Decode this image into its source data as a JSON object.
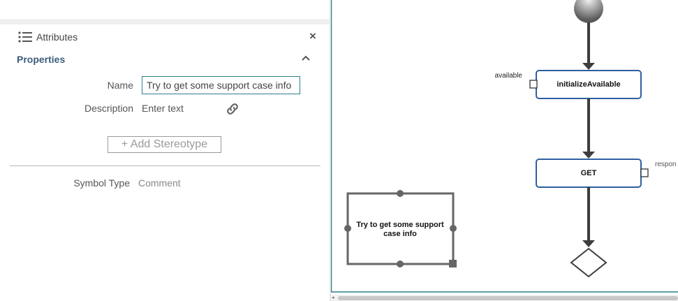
{
  "panel": {
    "title": "Attributes",
    "close_label": "×",
    "section_title": "Properties",
    "fields": {
      "name_label": "Name",
      "name_value": "Try to get some support case info",
      "description_label": "Description",
      "description_value": "Enter text",
      "stereotype_button": "+ Add Stereotype",
      "symbol_type_label": "Symbol Type",
      "symbol_type_value": "Comment"
    }
  },
  "diagram": {
    "nodes": {
      "initialize": "initializeAvailable",
      "get": "GET",
      "comment": [
        "Try to get some support",
        "case info"
      ]
    },
    "ports": {
      "available": "available",
      "response": "respon"
    }
  },
  "colors": {
    "accent": "#2e7d8c",
    "node_border": "#2f5f9e",
    "edge": "#3d3d3d",
    "section_title": "#3b5d7a"
  },
  "icons": [
    "list-icon",
    "close-icon",
    "chevron-up-icon",
    "link-icon"
  ]
}
